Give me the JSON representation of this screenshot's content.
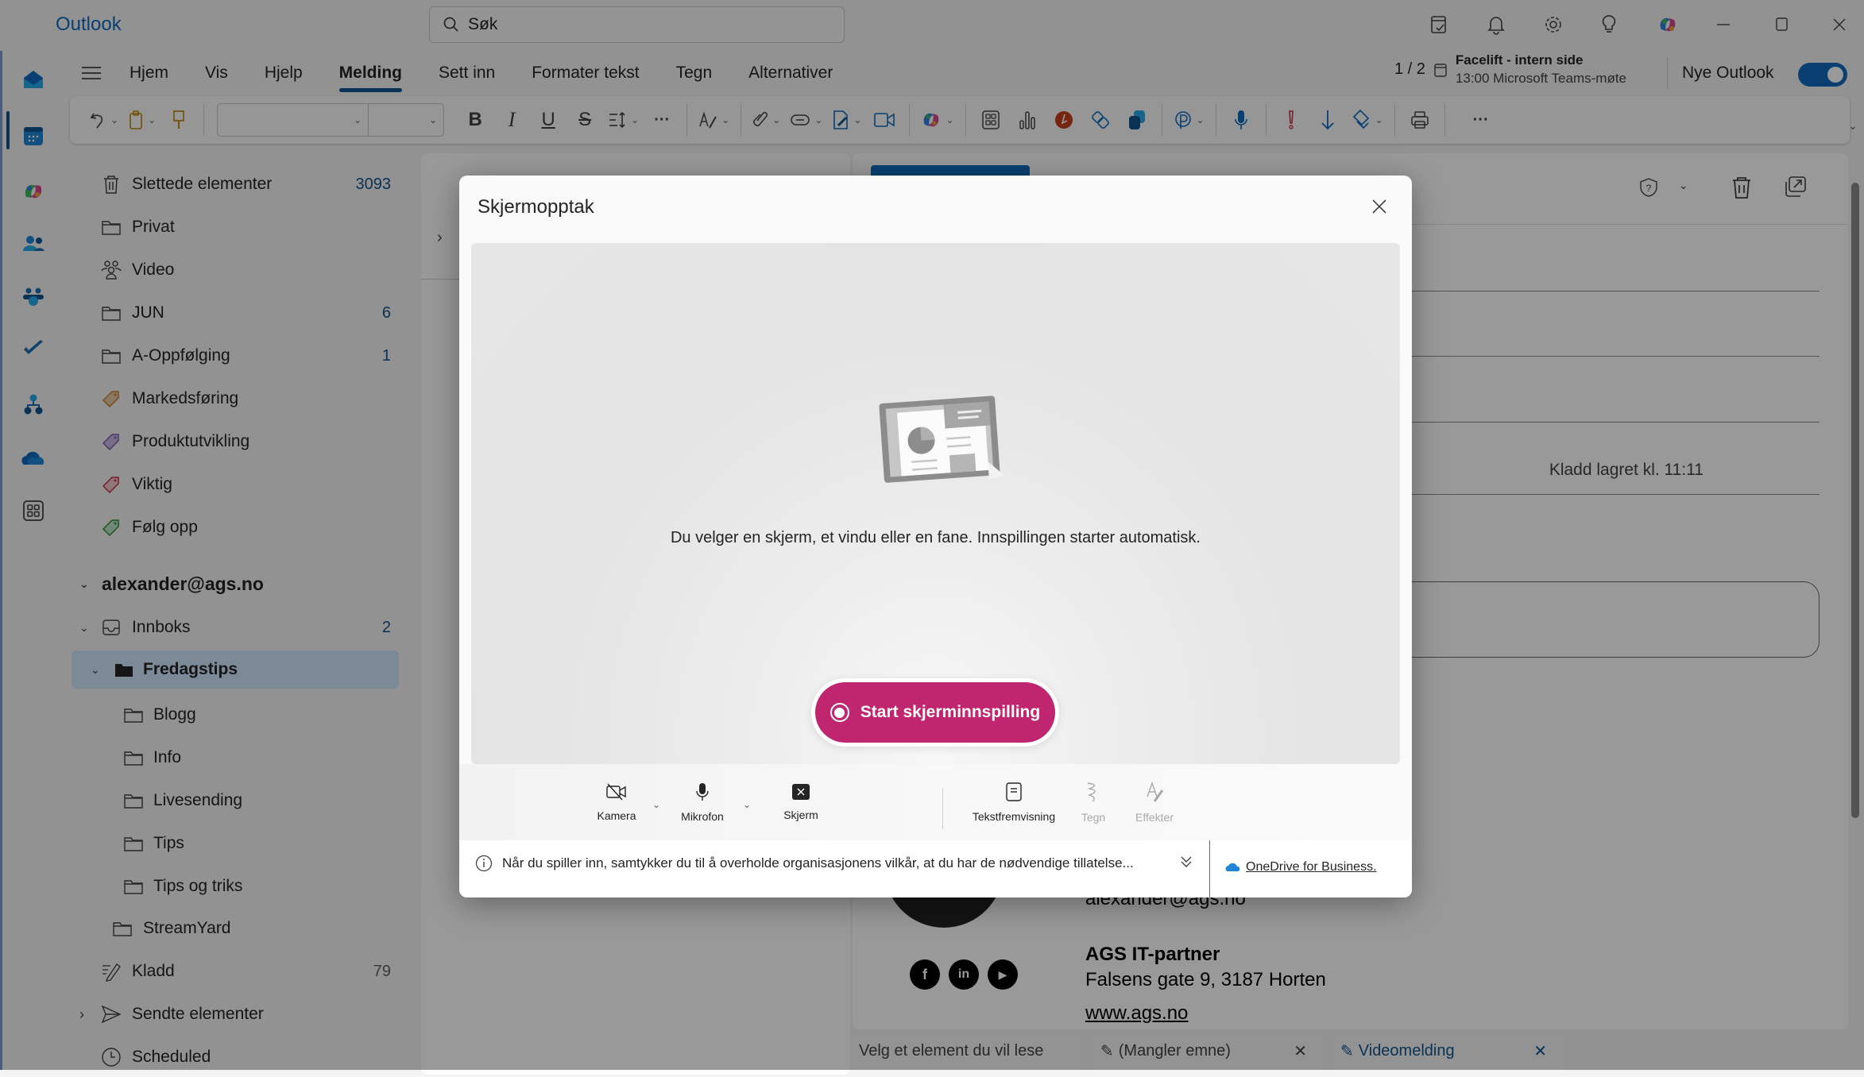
{
  "window": {
    "app_title": "Outlook",
    "search_placeholder": "Søk",
    "title_icons": [
      "my-day-icon",
      "bell-icon",
      "gear-icon",
      "lightbulb-icon",
      "copilot-icon"
    ],
    "controls": [
      "minimize",
      "maximize",
      "close"
    ]
  },
  "rail": {
    "items": [
      "mail",
      "calendar",
      "copilot",
      "people",
      "teams",
      "to-do",
      "org-explorer",
      "onedrive",
      "more-apps"
    ]
  },
  "ribbon": {
    "tabs": [
      {
        "label": "Hjem",
        "active": false
      },
      {
        "label": "Vis",
        "active": false
      },
      {
        "label": "Hjelp",
        "active": false
      },
      {
        "label": "Melding",
        "active": true
      },
      {
        "label": "Sett inn",
        "active": false
      },
      {
        "label": "Formater tekst",
        "active": false
      },
      {
        "label": "Tegn",
        "active": false
      },
      {
        "label": "Alternativer",
        "active": false
      }
    ],
    "font_name": "",
    "font_size": ""
  },
  "meeting": {
    "counter": "1 / 2",
    "title": "Facelift - intern side",
    "subtitle": "13:00 Microsoft Teams-møte"
  },
  "new_outlook": {
    "label": "Nye Outlook",
    "enabled": true
  },
  "folders": {
    "top": [
      {
        "label": "Slettede elementer",
        "count": "3093",
        "icon": "trash"
      },
      {
        "label": "Privat",
        "count": "",
        "icon": "folder"
      },
      {
        "label": "Video",
        "count": "",
        "icon": "group"
      },
      {
        "label": "JUN",
        "count": "6",
        "icon": "folder"
      },
      {
        "label": "A-Oppfølging",
        "count": "1",
        "icon": "folder"
      },
      {
        "label": "Markedsføring",
        "count": "",
        "icon": "tag",
        "color": "#c67f3a"
      },
      {
        "label": "Produktutvikling",
        "count": "",
        "icon": "tag",
        "color": "#7b5ea7"
      },
      {
        "label": "Viktig",
        "count": "",
        "icon": "tag",
        "color": "#c4314b"
      },
      {
        "label": "Følg opp",
        "count": "",
        "icon": "tag",
        "color": "#2e8b3a"
      }
    ],
    "account": "alexander@ags.no",
    "inbox": {
      "label": "Innboks",
      "count": "2"
    },
    "selected": {
      "label": "Fredagstips"
    },
    "subfolders": [
      "Blogg",
      "Info",
      "Livesending",
      "Tips",
      "Tips og triks"
    ],
    "streamyard": "StreamYard",
    "drafts": {
      "label": "Kladd",
      "count": "79"
    },
    "sent": {
      "label": "Sendte elementer"
    },
    "scheduled": {
      "label": "Scheduled"
    }
  },
  "compose": {
    "draft_saved": "Kladd lagret kl. 11:11",
    "signature": {
      "email": "alexander@ags.no",
      "company": "AGS IT-partner",
      "address": "Falsens gate 9, 3187 Horten",
      "website": "www.ags.no"
    }
  },
  "bottom_tabs": [
    {
      "label": "Velg et element du vil lese",
      "closable": false,
      "active": false
    },
    {
      "label": "(Mangler emne)",
      "closable": true,
      "active": false
    },
    {
      "label": "Videomelding",
      "closable": true,
      "active": true
    }
  ],
  "dialog": {
    "title": "Skjermopptak",
    "message": "Du velger en skjerm, et vindu eller en fane. Innspillingen starter automatisk.",
    "start_button": "Start skjerminnspilling",
    "controls": [
      {
        "label": "Kamera",
        "enabled": true,
        "has_dropdown": true
      },
      {
        "label": "Mikrofon",
        "enabled": true,
        "has_dropdown": true
      },
      {
        "label": "Skjerm",
        "enabled": true,
        "has_dropdown": false
      },
      {
        "label": "Tekstfremvisning",
        "enabled": true,
        "has_dropdown": false
      },
      {
        "label": "Tegn",
        "enabled": false,
        "has_dropdown": false
      },
      {
        "label": "Effekter",
        "enabled": false,
        "has_dropdown": false
      }
    ],
    "consent": "Når du spiller inn, samtykker du til å overholde organisasjonens vilkår, at du har de nødvendige tillatelse...",
    "storage_link": "OneDrive for Business."
  }
}
